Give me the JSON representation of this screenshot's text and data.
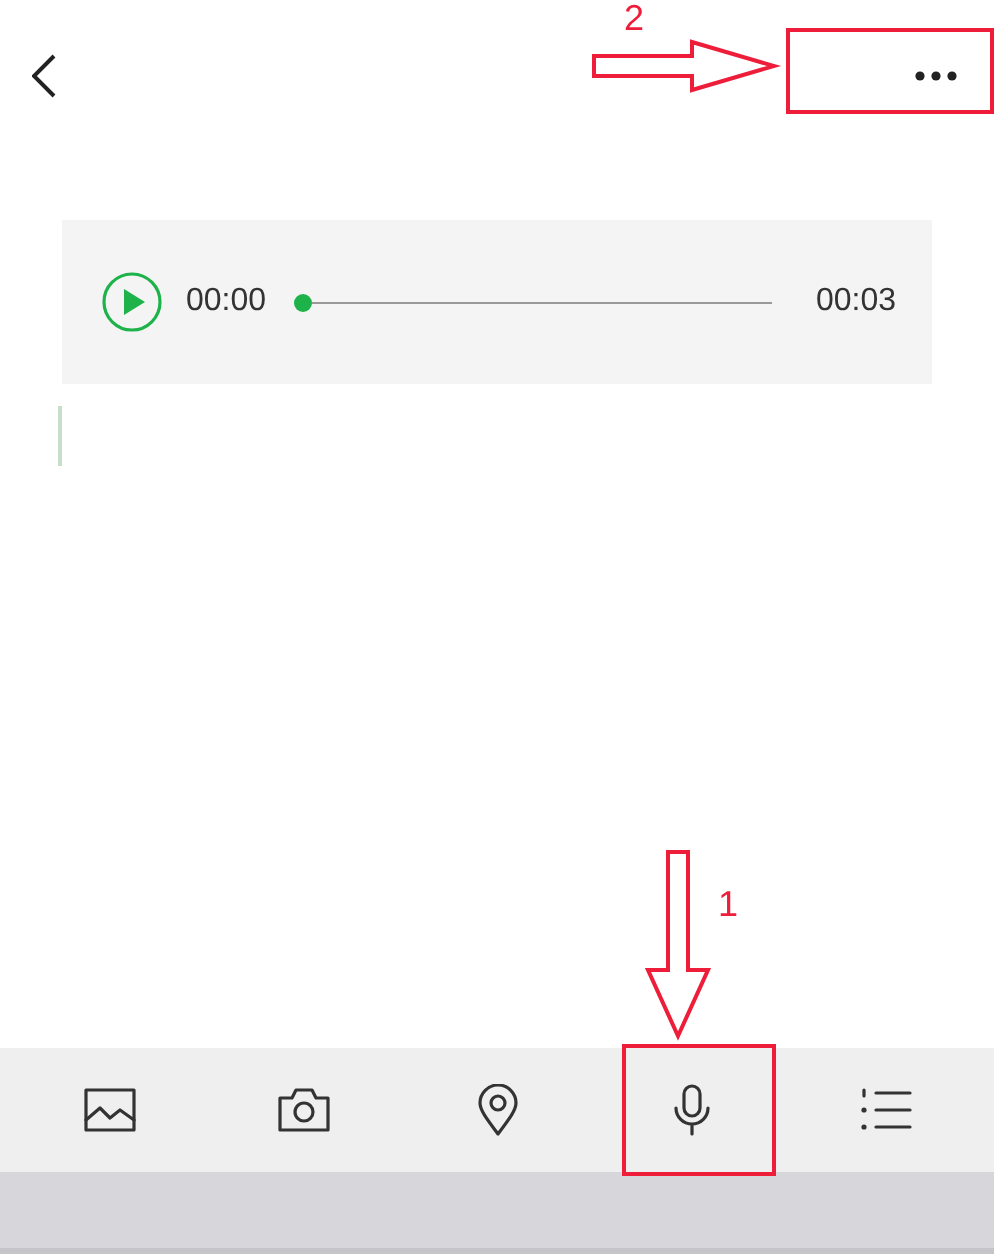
{
  "recording": {
    "elapsed": "00:00",
    "duration": "00:03",
    "level": 0
  },
  "toolbar": [
    {
      "kind": "image"
    },
    {
      "kind": "camera"
    },
    {
      "kind": "location"
    },
    {
      "kind": "microphone"
    },
    {
      "kind": "list"
    }
  ],
  "annotations": [
    {
      "label": "1",
      "kind": "down"
    },
    {
      "label": "2",
      "kind": "right"
    }
  ]
}
